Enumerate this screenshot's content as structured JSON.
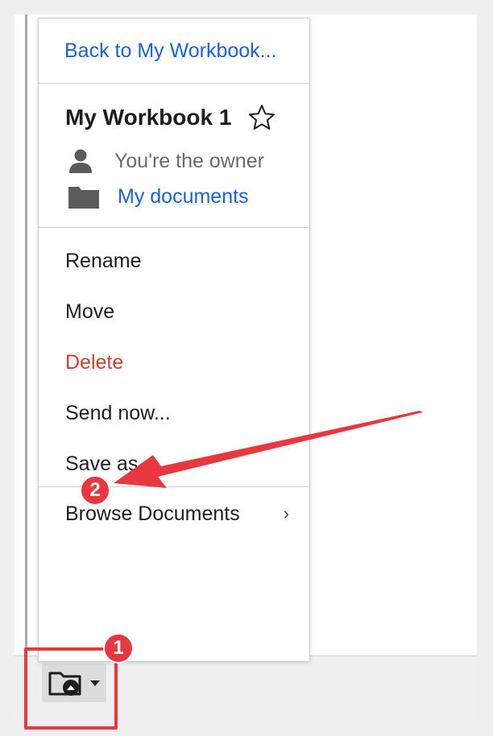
{
  "menu": {
    "back_link": "Back to My Workbook...",
    "workbook_title": "My Workbook 1",
    "owner_text": "You're the owner",
    "location_link": "My documents",
    "actions": {
      "rename": "Rename",
      "move": "Move",
      "delete": "Delete",
      "send_now": "Send now...",
      "save_as": "Save as..."
    },
    "browse": "Browse Documents",
    "browse_chevron": "›"
  },
  "annotations": {
    "badge_1": "1",
    "badge_2": "2",
    "color": "#e8373f"
  },
  "colors": {
    "link": "#1a62d8",
    "danger": "#d0402a",
    "text": "#1d1d1d",
    "muted": "#6b6b6b"
  },
  "icons": [
    "star-icon",
    "user-icon",
    "folder-icon",
    "chevron-right-icon",
    "folder-share-icon",
    "caret-down-icon"
  ]
}
